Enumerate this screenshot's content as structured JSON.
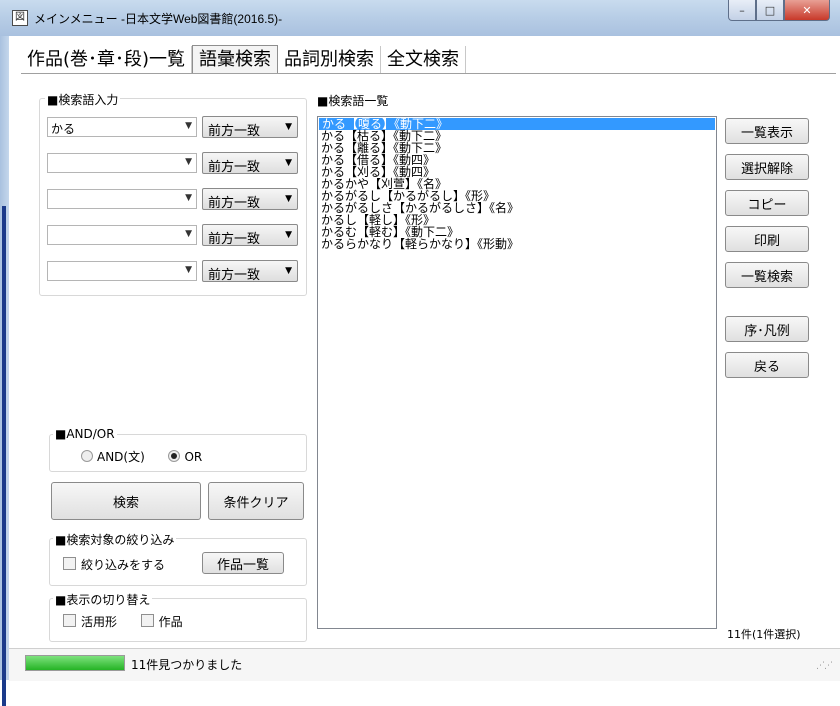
{
  "window": {
    "title": "メインメニュー -日本文学Web図書館(2016.5)-",
    "icon_glyph": "図",
    "controls": {
      "minimize": "–",
      "maximize": "□",
      "close": "✕"
    }
  },
  "tabs": [
    {
      "label": "作品(巻･章･段)一覧",
      "active": false
    },
    {
      "label": "語彙検索",
      "active": true
    },
    {
      "label": "品詞別検索",
      "active": false
    },
    {
      "label": "全文検索",
      "active": false
    }
  ],
  "input_group": {
    "title": "■検索語入力",
    "rows": [
      {
        "value": "かる",
        "mode": "前方一致"
      },
      {
        "value": "",
        "mode": "前方一致"
      },
      {
        "value": "",
        "mode": "前方一致"
      },
      {
        "value": "",
        "mode": "前方一致"
      },
      {
        "value": "",
        "mode": "前方一致"
      }
    ]
  },
  "andor": {
    "title": "■AND/OR",
    "options": [
      "AND(文)",
      "OR"
    ],
    "selected": "OR"
  },
  "actions": {
    "search": "検索",
    "clear": "条件クリア"
  },
  "filter": {
    "title": "■検索対象の絞り込み",
    "checkbox_label": "絞り込みをする",
    "works_button": "作品一覧"
  },
  "display": {
    "title": "■表示の切り替え",
    "options": [
      "活用形",
      "作品"
    ]
  },
  "results": {
    "title": "■検索語一覧",
    "items": [
      "かる【嗄る】《動下二》",
      "かる【枯る】《動下二》",
      "かる【離る】《動下二》",
      "かる【借る】《動四》",
      "かる【刈る】《動四》",
      "かるかや【刈萱】《名》",
      "かるがるし【かるがるし】《形》",
      "かるがるしさ【かるがるしさ】《名》",
      "かるし【軽し】《形》",
      "かるむ【軽む】《動下二》",
      "かるらかなり【軽らかなり】《形動》"
    ],
    "selected_index": 0,
    "count_text": "11件(1件選択)"
  },
  "side_buttons": [
    "一覧表示",
    "選択解除",
    "コピー",
    "印刷",
    "一覧検索",
    "序･凡例",
    "戻る"
  ],
  "status": {
    "text": "11件見つかりました",
    "progress": 1.0
  }
}
